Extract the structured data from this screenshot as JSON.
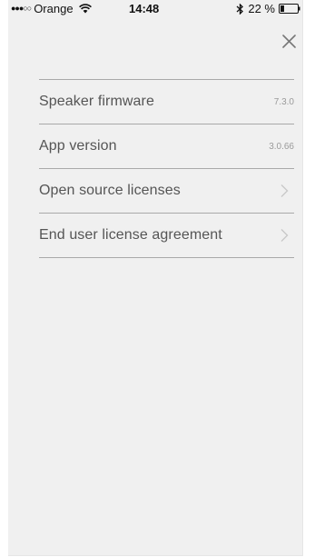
{
  "status_bar": {
    "signal": "●●●○○",
    "carrier": "Orange",
    "time": "14:48",
    "battery_percent": "22 %",
    "battery_level": 0.22,
    "icons": [
      "wifi-icon",
      "bluetooth-icon",
      "battery-icon"
    ]
  },
  "header": {
    "close_icon": "close-icon"
  },
  "info_list": {
    "rows": [
      {
        "label": "Speaker firmware",
        "value": "7.3.0"
      },
      {
        "label": "App version",
        "value": "3.0.66"
      },
      {
        "label": "Open source licenses",
        "icon": "chevron-right-icon"
      },
      {
        "label": "End user license agreement",
        "icon": "chevron-right-icon"
      }
    ]
  },
  "colors": {
    "background": "#f0f0f0",
    "label_text": "#555555",
    "value_text": "#9a9a9a",
    "divider": "#a9a9a9",
    "chevron": "#c8c8c8",
    "close_icon": "#777777"
  }
}
